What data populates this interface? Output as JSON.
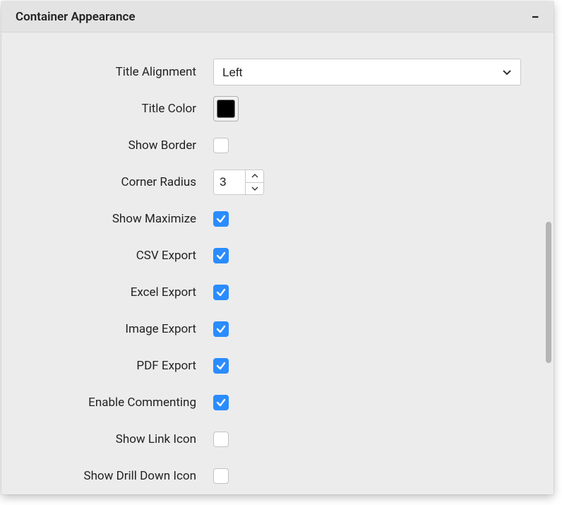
{
  "panel": {
    "title": "Container Appearance",
    "collapse_glyph": "−"
  },
  "fields": {
    "title_alignment": {
      "label": "Title Alignment",
      "value": "Left"
    },
    "title_color": {
      "label": "Title Color",
      "value": "#000000"
    },
    "show_border": {
      "label": "Show Border",
      "checked": false
    },
    "corner_radius": {
      "label": "Corner Radius",
      "value": "3"
    },
    "show_maximize": {
      "label": "Show Maximize",
      "checked": true
    },
    "csv_export": {
      "label": "CSV Export",
      "checked": true
    },
    "excel_export": {
      "label": "Excel Export",
      "checked": true
    },
    "image_export": {
      "label": "Image Export",
      "checked": true
    },
    "pdf_export": {
      "label": "PDF Export",
      "checked": true
    },
    "enable_commenting": {
      "label": "Enable Commenting",
      "checked": true
    },
    "show_link_icon": {
      "label": "Show Link Icon",
      "checked": false
    },
    "show_drill_down_icon": {
      "label": "Show Drill Down Icon",
      "checked": false
    }
  }
}
